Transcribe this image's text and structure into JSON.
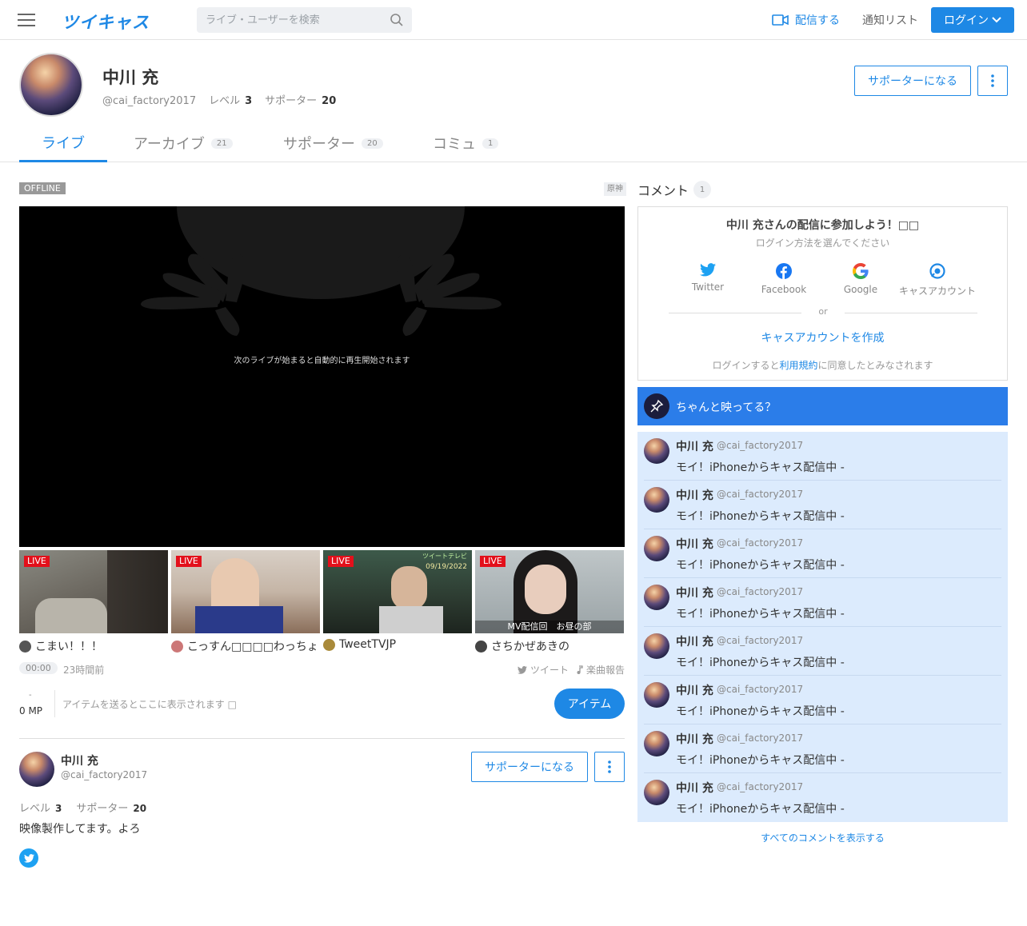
{
  "header": {
    "logo": "ツイキャス",
    "search_placeholder": "ライブ・ユーザーを検索",
    "broadcast_label": "配信する",
    "notify_label": "通知リスト",
    "login_label": "ログイン"
  },
  "profile": {
    "name": "中川 充",
    "handle": "@cai_factory2017",
    "level_label": "レベル",
    "level": "3",
    "supporter_label": "サポーター",
    "supporters": "20",
    "become_supporter": "サポーターになる",
    "bio": "映像製作してます。よろ"
  },
  "tabs": [
    {
      "label": "ライブ",
      "count": ""
    },
    {
      "label": "アーカイブ",
      "count": "21"
    },
    {
      "label": "サポーター",
      "count": "20"
    },
    {
      "label": "コミュ",
      "count": "1"
    }
  ],
  "player": {
    "status": "OFFLINE",
    "genre": "原神",
    "message": "次のライブが始まると自動的に再生開始されます"
  },
  "live_badge": "LIVE",
  "lives": [
    {
      "title": "こまい！！！",
      "caption": ""
    },
    {
      "title": "こっすん□□□□わっちょ",
      "caption": ""
    },
    {
      "title": "TweetTVJP",
      "caption": ""
    },
    {
      "title": "さちかぜあきの",
      "caption": "MV配信回　お昼の部"
    }
  ],
  "stream_info": {
    "duration": "00:00",
    "ago": "23時間前",
    "tweet": "ツイート",
    "song_report": "楽曲報告"
  },
  "items": {
    "mp_dash": "-",
    "mp": "0 MP",
    "message": "アイテムを送るとここに表示されます □",
    "button": "アイテム"
  },
  "comments": {
    "title": "コメント",
    "count": "1",
    "join_title": "中川 充さんの配信に参加しよう！□□",
    "join_sub": "ログイン方法を選んでください",
    "sns": [
      "Twitter",
      "Facebook",
      "Google",
      "キャスアカウント"
    ],
    "or": "or",
    "create_account": "キャスアカウントを作成",
    "terms_before": "ログインすると",
    "terms_link": "利用規約",
    "terms_after": "に同意したとみなされます",
    "pinned": "ちゃんと映ってる？",
    "list": [
      {
        "name": "中川 充",
        "handle": "@cai_factory2017",
        "text": "モイ！iPhoneからキャス配信中 -"
      },
      {
        "name": "中川 充",
        "handle": "@cai_factory2017",
        "text": "モイ！iPhoneからキャス配信中 -"
      },
      {
        "name": "中川 充",
        "handle": "@cai_factory2017",
        "text": "モイ！iPhoneからキャス配信中 -"
      },
      {
        "name": "中川 充",
        "handle": "@cai_factory2017",
        "text": "モイ！iPhoneからキャス配信中 -"
      },
      {
        "name": "中川 充",
        "handle": "@cai_factory2017",
        "text": "モイ！iPhoneからキャス配信中 -"
      },
      {
        "name": "中川 充",
        "handle": "@cai_factory2017",
        "text": "モイ！iPhoneからキャス配信中 -"
      },
      {
        "name": "中川 充",
        "handle": "@cai_factory2017",
        "text": "モイ！iPhoneからキャス配信中 -"
      },
      {
        "name": "中川 充",
        "handle": "@cai_factory2017",
        "text": "モイ！iPhoneからキャス配信中 -"
      }
    ],
    "show_all": "すべてのコメントを表示する"
  },
  "colors": {
    "accent": "#1e88e5",
    "live_red": "#e3101b",
    "comment_bg": "#dcebfd",
    "pinned_bg": "#2b7de9"
  },
  "icons": [
    "menu-icon",
    "search-icon",
    "video-camera-icon",
    "chevron-down-icon",
    "more-vertical-icon",
    "twitter-icon",
    "facebook-icon",
    "google-icon",
    "twitcasting-icon",
    "pin-icon",
    "music-note-icon"
  ]
}
